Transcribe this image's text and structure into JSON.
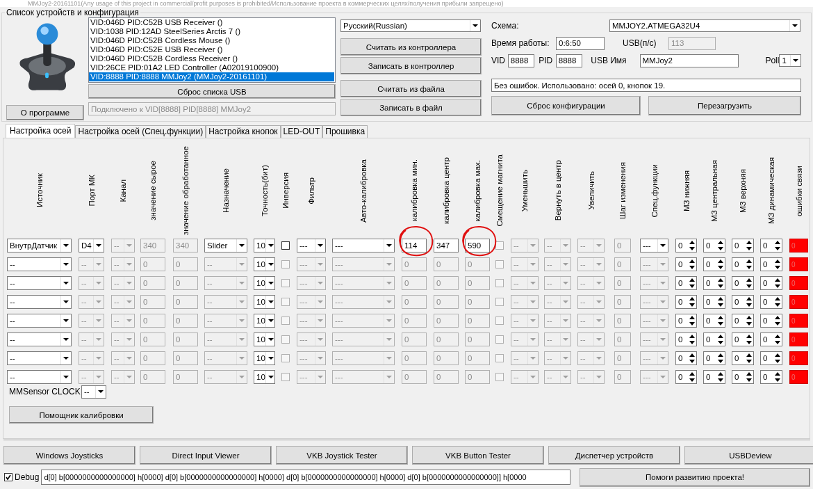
{
  "window": {
    "title": "MMJoy2-20161101(Any usage of this project in commercial/profit purposes is prohibited/Использование проекта в коммерческих целях/получения прибыли запрещено)"
  },
  "group": {
    "title": "Список устройств и конфигурация"
  },
  "devices": [
    {
      "text": "VID:046D PID:C52B USB Receiver ()",
      "selected": false
    },
    {
      "text": "VID:1038 PID:12AD SteelSeries Arctis 7 ()",
      "selected": false
    },
    {
      "text": "VID:046D PID:C52B Cordless Mouse ()",
      "selected": false
    },
    {
      "text": "VID:046D PID:C52E USB Receiver ()",
      "selected": false
    },
    {
      "text": "VID:046D PID:C52B Cordless Receiver ()",
      "selected": false
    },
    {
      "text": "VID:26CE PID:01A2 LED Controller (A02019100900)",
      "selected": false
    },
    {
      "text": "VID:8888 PID:8888 MMJoy2 (MMJoy2-20161101)",
      "selected": true
    }
  ],
  "reset_usb_button": "Сброс списка USB",
  "about_button": "О программе",
  "connection_status": "Подключено к VID[8888] PID[8888] MMJoy2",
  "language": "Русский(Russian)",
  "controller_buttons": [
    "Считать из контроллера",
    "Записать в контроллер"
  ],
  "file_buttons": [
    "Считать из файла",
    "Записать в файл"
  ],
  "scheme": {
    "label": "Схема:",
    "value": "MMJOY2.ATMEGA32U4"
  },
  "uptime": {
    "label": "Время работы:",
    "value": "0:6:50"
  },
  "usb_rate": {
    "label": "USB(п/с)",
    "value": "113"
  },
  "vid": {
    "label": "VID",
    "value": "8888"
  },
  "pid": {
    "label": "PID",
    "value": "8888"
  },
  "usb_name": {
    "label": "USB Имя",
    "value": "MMJoy2"
  },
  "poll": {
    "label": "Poll",
    "value": "1"
  },
  "message": "Без ошибок. Использовано: осей  0, кнопок  19.",
  "config_buttons": [
    "Сброс конфигурации",
    "Перезагрузить"
  ],
  "tabs": [
    {
      "label": "Настройка осей",
      "selected": true
    },
    {
      "label": "Настройка осей (Спец.функции)",
      "selected": false
    },
    {
      "label": "Настройка кнопок",
      "selected": false
    },
    {
      "label": "LED-OUT",
      "selected": false
    },
    {
      "label": "Прошивка",
      "selected": false
    }
  ],
  "columns": [
    "Источник",
    "Порт МК",
    "Канал",
    "значение сырое",
    "значение обработанное",
    "Назначение",
    "Точность(бит)",
    "Инверсия",
    "Фильтр",
    "Авто-калибровка",
    "калибровка мин.",
    "калибровка центр",
    "калибровка мах.",
    "Смещение магнита",
    "Уменьшить",
    "Вернуть в центр",
    "Увеличить",
    "Шаг изменения",
    "Спец.функции",
    "МЗ нижняя",
    "МЗ центральная",
    "МЗ  верхняя",
    "МЗ динамическая",
    "ошибки связи"
  ],
  "rows": [
    {
      "cells": [
        {
          "kind": "combo",
          "value": "ВнутрДатчик",
          "disabled": false
        },
        {
          "kind": "combo",
          "value": "D4",
          "disabled": false
        },
        {
          "kind": "combo",
          "value": "--",
          "disabled": true
        },
        {
          "kind": "text",
          "value": "340",
          "disabled": true,
          "circled": false
        },
        {
          "kind": "text",
          "value": "340",
          "disabled": true,
          "circled": false
        },
        {
          "kind": "combo",
          "value": "Slider",
          "disabled": false
        },
        {
          "kind": "combo",
          "value": "10",
          "disabled": false
        },
        {
          "kind": "check",
          "checked": false,
          "disabled": false
        },
        {
          "kind": "combo",
          "value": "---",
          "disabled": false
        },
        {
          "kind": "combo",
          "value": "---",
          "disabled": false
        },
        {
          "kind": "text",
          "value": "114",
          "disabled": false,
          "circled": true
        },
        {
          "kind": "text",
          "value": "347",
          "disabled": false,
          "circled": false
        },
        {
          "kind": "text",
          "value": "590",
          "disabled": false,
          "circled": true
        },
        {
          "kind": "check",
          "checked": false,
          "disabled": true
        },
        {
          "kind": "combo",
          "value": "--",
          "disabled": true
        },
        {
          "kind": "combo",
          "value": "--",
          "disabled": true
        },
        {
          "kind": "combo",
          "value": "--",
          "disabled": true
        },
        {
          "kind": "text",
          "value": "0",
          "disabled": true,
          "circled": false
        },
        {
          "kind": "combo",
          "value": "---",
          "disabled": false
        },
        {
          "kind": "spin",
          "value": "0"
        },
        {
          "kind": "spin",
          "value": "0"
        },
        {
          "kind": "spin",
          "value": "0"
        },
        {
          "kind": "spin",
          "value": "0"
        },
        {
          "kind": "error",
          "value": "0",
          "color": "#ff0000"
        }
      ]
    },
    {
      "cells": [
        {
          "kind": "combo",
          "value": "--",
          "disabled": false
        },
        {
          "kind": "combo",
          "value": "--",
          "disabled": true
        },
        {
          "kind": "combo",
          "value": "--",
          "disabled": true
        },
        {
          "kind": "text",
          "value": "0",
          "disabled": true,
          "circled": false
        },
        {
          "kind": "text",
          "value": "0",
          "disabled": true,
          "circled": false
        },
        {
          "kind": "combo",
          "value": "--",
          "disabled": true
        },
        {
          "kind": "combo",
          "value": "10",
          "disabled": false
        },
        {
          "kind": "check",
          "checked": false,
          "disabled": true
        },
        {
          "kind": "combo",
          "value": "---",
          "disabled": true
        },
        {
          "kind": "combo",
          "value": "---",
          "disabled": true
        },
        {
          "kind": "text",
          "value": "0",
          "disabled": true,
          "circled": false
        },
        {
          "kind": "text",
          "value": "0",
          "disabled": true,
          "circled": false
        },
        {
          "kind": "text",
          "value": "0",
          "disabled": true,
          "circled": false
        },
        {
          "kind": "check",
          "checked": false,
          "disabled": true
        },
        {
          "kind": "combo",
          "value": "--",
          "disabled": true
        },
        {
          "kind": "combo",
          "value": "--",
          "disabled": true
        },
        {
          "kind": "combo",
          "value": "--",
          "disabled": true
        },
        {
          "kind": "text",
          "value": "0",
          "disabled": true,
          "circled": false
        },
        {
          "kind": "combo",
          "value": "---",
          "disabled": true
        },
        {
          "kind": "spin",
          "value": "0"
        },
        {
          "kind": "spin",
          "value": "0"
        },
        {
          "kind": "spin",
          "value": "0"
        },
        {
          "kind": "spin",
          "value": "0"
        },
        {
          "kind": "error",
          "value": "0",
          "color": "#ff0000"
        }
      ]
    },
    {
      "cells": [
        {
          "kind": "combo",
          "value": "--",
          "disabled": false
        },
        {
          "kind": "combo",
          "value": "--",
          "disabled": true
        },
        {
          "kind": "combo",
          "value": "--",
          "disabled": true
        },
        {
          "kind": "text",
          "value": "0",
          "disabled": true,
          "circled": false
        },
        {
          "kind": "text",
          "value": "0",
          "disabled": true,
          "circled": false
        },
        {
          "kind": "combo",
          "value": "--",
          "disabled": true
        },
        {
          "kind": "combo",
          "value": "10",
          "disabled": false
        },
        {
          "kind": "check",
          "checked": false,
          "disabled": true
        },
        {
          "kind": "combo",
          "value": "---",
          "disabled": true
        },
        {
          "kind": "combo",
          "value": "---",
          "disabled": true
        },
        {
          "kind": "text",
          "value": "0",
          "disabled": true,
          "circled": false
        },
        {
          "kind": "text",
          "value": "0",
          "disabled": true,
          "circled": false
        },
        {
          "kind": "text",
          "value": "0",
          "disabled": true,
          "circled": false
        },
        {
          "kind": "check",
          "checked": false,
          "disabled": true
        },
        {
          "kind": "combo",
          "value": "--",
          "disabled": true
        },
        {
          "kind": "combo",
          "value": "--",
          "disabled": true
        },
        {
          "kind": "combo",
          "value": "--",
          "disabled": true
        },
        {
          "kind": "text",
          "value": "0",
          "disabled": true,
          "circled": false
        },
        {
          "kind": "combo",
          "value": "---",
          "disabled": true
        },
        {
          "kind": "spin",
          "value": "0"
        },
        {
          "kind": "spin",
          "value": "0"
        },
        {
          "kind": "spin",
          "value": "0"
        },
        {
          "kind": "spin",
          "value": "0"
        },
        {
          "kind": "error",
          "value": "0",
          "color": "#ff0000"
        }
      ]
    },
    {
      "cells": [
        {
          "kind": "combo",
          "value": "--",
          "disabled": false
        },
        {
          "kind": "combo",
          "value": "--",
          "disabled": true
        },
        {
          "kind": "combo",
          "value": "--",
          "disabled": true
        },
        {
          "kind": "text",
          "value": "0",
          "disabled": true,
          "circled": false
        },
        {
          "kind": "text",
          "value": "0",
          "disabled": true,
          "circled": false
        },
        {
          "kind": "combo",
          "value": "--",
          "disabled": true
        },
        {
          "kind": "combo",
          "value": "10",
          "disabled": false
        },
        {
          "kind": "check",
          "checked": false,
          "disabled": true
        },
        {
          "kind": "combo",
          "value": "---",
          "disabled": true
        },
        {
          "kind": "combo",
          "value": "---",
          "disabled": true
        },
        {
          "kind": "text",
          "value": "0",
          "disabled": true,
          "circled": false
        },
        {
          "kind": "text",
          "value": "0",
          "disabled": true,
          "circled": false
        },
        {
          "kind": "text",
          "value": "0",
          "disabled": true,
          "circled": false
        },
        {
          "kind": "check",
          "checked": false,
          "disabled": true
        },
        {
          "kind": "combo",
          "value": "--",
          "disabled": true
        },
        {
          "kind": "combo",
          "value": "--",
          "disabled": true
        },
        {
          "kind": "combo",
          "value": "--",
          "disabled": true
        },
        {
          "kind": "text",
          "value": "0",
          "disabled": true,
          "circled": false
        },
        {
          "kind": "combo",
          "value": "---",
          "disabled": true
        },
        {
          "kind": "spin",
          "value": "0"
        },
        {
          "kind": "spin",
          "value": "0"
        },
        {
          "kind": "spin",
          "value": "0"
        },
        {
          "kind": "spin",
          "value": "0"
        },
        {
          "kind": "error",
          "value": "0",
          "color": "#ff0000"
        }
      ]
    },
    {
      "cells": [
        {
          "kind": "combo",
          "value": "--",
          "disabled": false
        },
        {
          "kind": "combo",
          "value": "--",
          "disabled": true
        },
        {
          "kind": "combo",
          "value": "--",
          "disabled": true
        },
        {
          "kind": "text",
          "value": "0",
          "disabled": true,
          "circled": false
        },
        {
          "kind": "text",
          "value": "0",
          "disabled": true,
          "circled": false
        },
        {
          "kind": "combo",
          "value": "--",
          "disabled": true
        },
        {
          "kind": "combo",
          "value": "10",
          "disabled": false
        },
        {
          "kind": "check",
          "checked": false,
          "disabled": true
        },
        {
          "kind": "combo",
          "value": "---",
          "disabled": true
        },
        {
          "kind": "combo",
          "value": "---",
          "disabled": true
        },
        {
          "kind": "text",
          "value": "0",
          "disabled": true,
          "circled": false
        },
        {
          "kind": "text",
          "value": "0",
          "disabled": true,
          "circled": false
        },
        {
          "kind": "text",
          "value": "0",
          "disabled": true,
          "circled": false
        },
        {
          "kind": "check",
          "checked": false,
          "disabled": true
        },
        {
          "kind": "combo",
          "value": "--",
          "disabled": true
        },
        {
          "kind": "combo",
          "value": "--",
          "disabled": true
        },
        {
          "kind": "combo",
          "value": "--",
          "disabled": true
        },
        {
          "kind": "text",
          "value": "0",
          "disabled": true,
          "circled": false
        },
        {
          "kind": "combo",
          "value": "---",
          "disabled": true
        },
        {
          "kind": "spin",
          "value": "0"
        },
        {
          "kind": "spin",
          "value": "0"
        },
        {
          "kind": "spin",
          "value": "0"
        },
        {
          "kind": "spin",
          "value": "0"
        },
        {
          "kind": "error",
          "value": "0",
          "color": "#ff0000"
        }
      ]
    },
    {
      "cells": [
        {
          "kind": "combo",
          "value": "--",
          "disabled": false
        },
        {
          "kind": "combo",
          "value": "--",
          "disabled": true
        },
        {
          "kind": "combo",
          "value": "--",
          "disabled": true
        },
        {
          "kind": "text",
          "value": "0",
          "disabled": true,
          "circled": false
        },
        {
          "kind": "text",
          "value": "0",
          "disabled": true,
          "circled": false
        },
        {
          "kind": "combo",
          "value": "--",
          "disabled": true
        },
        {
          "kind": "combo",
          "value": "10",
          "disabled": false
        },
        {
          "kind": "check",
          "checked": false,
          "disabled": true
        },
        {
          "kind": "combo",
          "value": "---",
          "disabled": true
        },
        {
          "kind": "combo",
          "value": "---",
          "disabled": true
        },
        {
          "kind": "text",
          "value": "0",
          "disabled": true,
          "circled": false
        },
        {
          "kind": "text",
          "value": "0",
          "disabled": true,
          "circled": false
        },
        {
          "kind": "text",
          "value": "0",
          "disabled": true,
          "circled": false
        },
        {
          "kind": "check",
          "checked": false,
          "disabled": true
        },
        {
          "kind": "combo",
          "value": "--",
          "disabled": true
        },
        {
          "kind": "combo",
          "value": "--",
          "disabled": true
        },
        {
          "kind": "combo",
          "value": "--",
          "disabled": true
        },
        {
          "kind": "text",
          "value": "0",
          "disabled": true,
          "circled": false
        },
        {
          "kind": "combo",
          "value": "---",
          "disabled": true
        },
        {
          "kind": "spin",
          "value": "0"
        },
        {
          "kind": "spin",
          "value": "0"
        },
        {
          "kind": "spin",
          "value": "0"
        },
        {
          "kind": "spin",
          "value": "0"
        },
        {
          "kind": "error",
          "value": "0",
          "color": "#ff0000"
        }
      ]
    },
    {
      "cells": [
        {
          "kind": "combo",
          "value": "--",
          "disabled": false
        },
        {
          "kind": "combo",
          "value": "--",
          "disabled": true
        },
        {
          "kind": "combo",
          "value": "--",
          "disabled": true
        },
        {
          "kind": "text",
          "value": "0",
          "disabled": true,
          "circled": false
        },
        {
          "kind": "text",
          "value": "0",
          "disabled": true,
          "circled": false
        },
        {
          "kind": "combo",
          "value": "--",
          "disabled": true
        },
        {
          "kind": "combo",
          "value": "10",
          "disabled": false
        },
        {
          "kind": "check",
          "checked": false,
          "disabled": true
        },
        {
          "kind": "combo",
          "value": "---",
          "disabled": true
        },
        {
          "kind": "combo",
          "value": "---",
          "disabled": true
        },
        {
          "kind": "text",
          "value": "0",
          "disabled": true,
          "circled": false
        },
        {
          "kind": "text",
          "value": "0",
          "disabled": true,
          "circled": false
        },
        {
          "kind": "text",
          "value": "0",
          "disabled": true,
          "circled": false
        },
        {
          "kind": "check",
          "checked": false,
          "disabled": true
        },
        {
          "kind": "combo",
          "value": "--",
          "disabled": true
        },
        {
          "kind": "combo",
          "value": "--",
          "disabled": true
        },
        {
          "kind": "combo",
          "value": "--",
          "disabled": true
        },
        {
          "kind": "text",
          "value": "0",
          "disabled": true,
          "circled": false
        },
        {
          "kind": "combo",
          "value": "---",
          "disabled": true
        },
        {
          "kind": "spin",
          "value": "0"
        },
        {
          "kind": "spin",
          "value": "0"
        },
        {
          "kind": "spin",
          "value": "0"
        },
        {
          "kind": "spin",
          "value": "0"
        },
        {
          "kind": "error",
          "value": "0",
          "color": "#ff0000"
        }
      ]
    },
    {
      "cells": [
        {
          "kind": "combo",
          "value": "--",
          "disabled": false
        },
        {
          "kind": "combo",
          "value": "--",
          "disabled": true
        },
        {
          "kind": "combo",
          "value": "--",
          "disabled": true
        },
        {
          "kind": "text",
          "value": "0",
          "disabled": true,
          "circled": false
        },
        {
          "kind": "text",
          "value": "0",
          "disabled": true,
          "circled": false
        },
        {
          "kind": "combo",
          "value": "--",
          "disabled": true
        },
        {
          "kind": "combo",
          "value": "10",
          "disabled": false
        },
        {
          "kind": "check",
          "checked": false,
          "disabled": true
        },
        {
          "kind": "combo",
          "value": "---",
          "disabled": true
        },
        {
          "kind": "combo",
          "value": "---",
          "disabled": true
        },
        {
          "kind": "text",
          "value": "0",
          "disabled": true,
          "circled": false
        },
        {
          "kind": "text",
          "value": "0",
          "disabled": true,
          "circled": false
        },
        {
          "kind": "text",
          "value": "0",
          "disabled": true,
          "circled": false
        },
        {
          "kind": "check",
          "checked": false,
          "disabled": true
        },
        {
          "kind": "combo",
          "value": "--",
          "disabled": true
        },
        {
          "kind": "combo",
          "value": "--",
          "disabled": true
        },
        {
          "kind": "combo",
          "value": "--",
          "disabled": true
        },
        {
          "kind": "text",
          "value": "0",
          "disabled": true,
          "circled": false
        },
        {
          "kind": "combo",
          "value": "---",
          "disabled": true
        },
        {
          "kind": "spin",
          "value": "0"
        },
        {
          "kind": "spin",
          "value": "0"
        },
        {
          "kind": "spin",
          "value": "0"
        },
        {
          "kind": "spin",
          "value": "0"
        },
        {
          "kind": "error",
          "value": "0",
          "color": "#ff0000"
        }
      ]
    }
  ],
  "sensor_clock": {
    "label": "MMSensor CLOCK",
    "value": "--"
  },
  "calibration_button": "Помощник калибровки",
  "tool_buttons": [
    "Windows Joysticks",
    "Direct Input Viewer",
    "VKB Joystick Tester",
    "VKB Button Tester",
    "Диспетчер устройств",
    "USBDeview"
  ],
  "debug": {
    "label": "Debug",
    "checked": true,
    "value": "d[0] b[0000000000000000] h[0000]   d[0] b[0000000000000000] h[0000]   d[0] b[0000000000000000] h[0000]   d[0] b[0000000000000000]] h[0000"
  },
  "donate_button": "Помоги развитию проекта!"
}
